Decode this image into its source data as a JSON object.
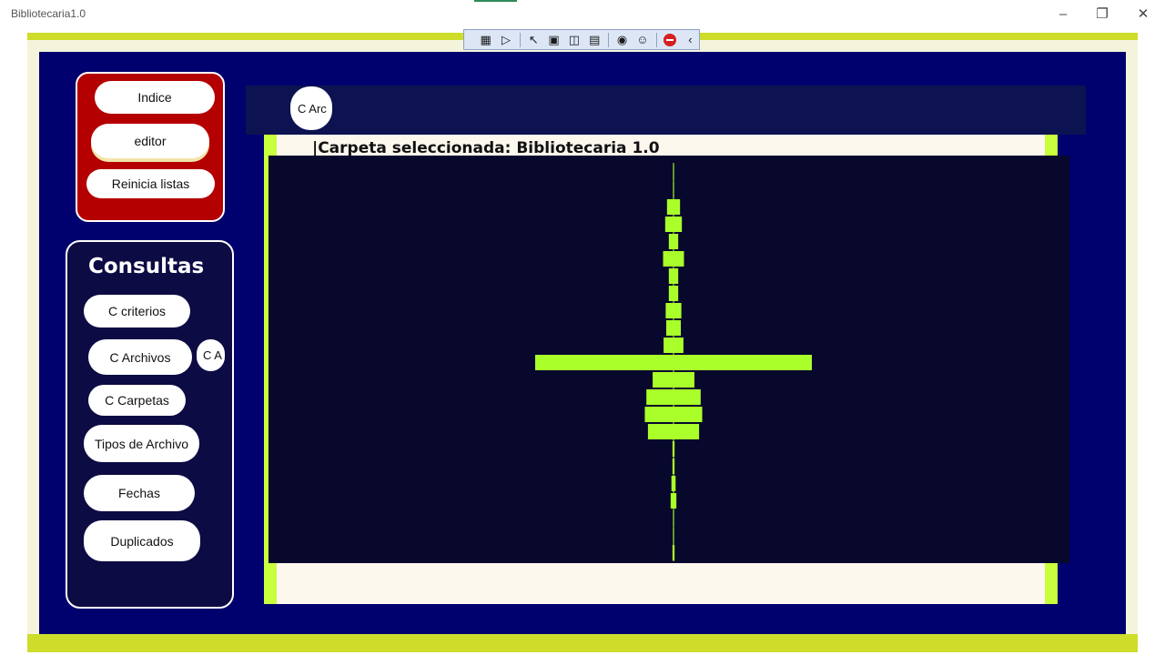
{
  "window": {
    "title": "Bibliotecaria1.0"
  },
  "menu": {
    "indice": "Indice",
    "editor": "editor",
    "reinicia": "Reinicia listas"
  },
  "consultas": {
    "title": "Consultas",
    "criterios": "C criterios",
    "archivos": "C Archivos",
    "archivos_clip": "C A",
    "carpetas": "C Carpetas",
    "tipos": "Tipos de Archivo",
    "fechas": "Fechas",
    "duplicados": "Duplicados"
  },
  "topbar": {
    "button": "C Arc"
  },
  "main": {
    "folder_label": "|Carpeta seleccionada: Bibliotecaria 1.0"
  },
  "colors": {
    "accent": "#cddd2a",
    "bar": "#aaff2a",
    "navy": "#00006e",
    "red": "#b40000"
  },
  "chart_data": {
    "type": "bar",
    "orientation": "horizontal-centered",
    "title": "",
    "xlabel": "",
    "ylabel": "",
    "values": [
      0.2,
      0.2,
      2.5,
      3.2,
      1.8,
      4.0,
      1.8,
      1.8,
      3.0,
      2.8,
      3.8,
      53,
      8.0,
      10.4,
      11.0,
      9.8,
      0.4,
      0.4,
      0.8,
      1.1,
      0.2,
      0.2,
      0.4
    ],
    "max_value": 53
  }
}
